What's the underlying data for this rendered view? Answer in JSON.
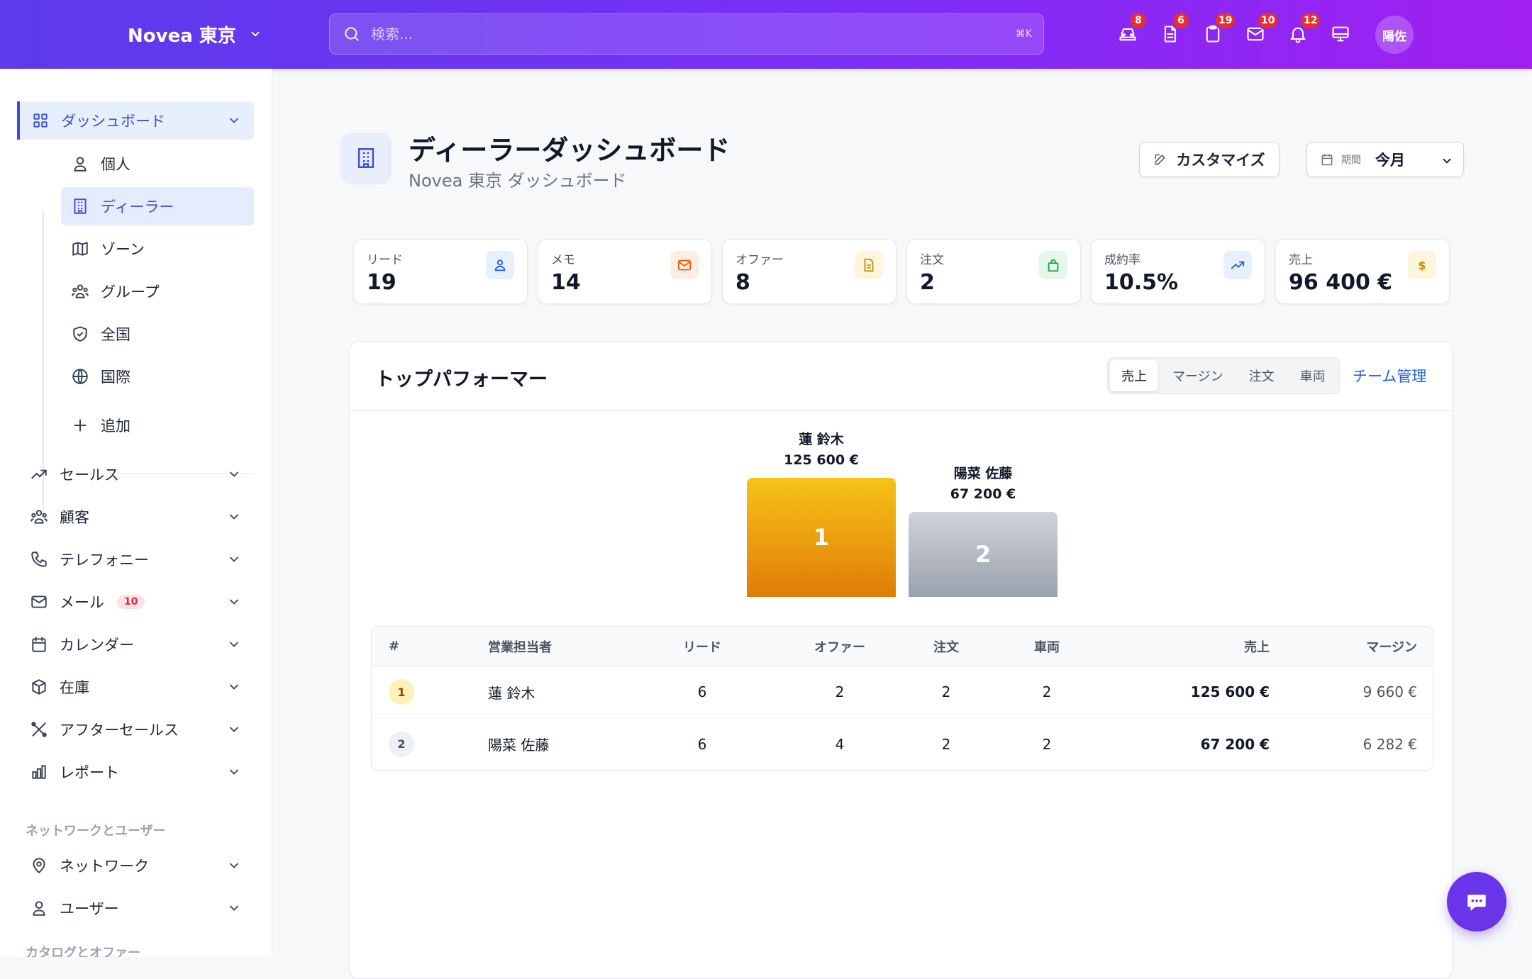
{
  "header": {
    "brand": "Novea 東京",
    "search_placeholder": "検索...",
    "shortcut": "⌘K",
    "icons": [
      {
        "name": "car-icon",
        "badge": "8"
      },
      {
        "name": "document-icon",
        "badge": "6"
      },
      {
        "name": "clipboard-icon",
        "badge": "19"
      },
      {
        "name": "mail-icon",
        "badge": "10"
      },
      {
        "name": "bell-icon",
        "badge": "12"
      },
      {
        "name": "monitor-icon",
        "badge": ""
      }
    ],
    "avatar": "陽佐"
  },
  "sidebar": {
    "dashboard": "ダッシュボード",
    "sub": [
      "個人",
      "ディーラー",
      "ゾーン",
      "グループ",
      "全国",
      "国際"
    ],
    "add": "追加",
    "items": [
      "セールス",
      "顧客",
      "テレフォニー",
      "メール",
      "カレンダー",
      "在庫",
      "アフターセールス",
      "レポート"
    ],
    "mail_badge": "10",
    "section_network": "ネットワークとユーザー",
    "network_items": [
      "ネットワーク",
      "ユーザー"
    ],
    "section_catalog": "カタログとオファー"
  },
  "page": {
    "title": "ディーラーダッシュボード",
    "subtitle": "Novea 東京 ダッシュボード",
    "customize": "カスタマイズ",
    "period_label": "期間",
    "period_value": "今月"
  },
  "kpis": [
    {
      "label": "リード",
      "value": "19",
      "icon": "user-icon",
      "color": "#2563eb",
      "bg": "#e8effd"
    },
    {
      "label": "メモ",
      "value": "14",
      "icon": "mail-icon",
      "color": "#ea580c",
      "bg": "#fdeee4"
    },
    {
      "label": "オファー",
      "value": "8",
      "icon": "document-icon",
      "color": "#ca8a04",
      "bg": "#fdf6dc"
    },
    {
      "label": "注文",
      "value": "2",
      "icon": "bag-icon",
      "color": "#16a34a",
      "bg": "#e4f7ea"
    },
    {
      "label": "成約率",
      "value": "10.5%",
      "icon": "trend-icon",
      "color": "#2563eb",
      "bg": "#e8effd"
    },
    {
      "label": "売上",
      "value": "96 400 €",
      "icon": "dollar-icon",
      "color": "#ca8a04",
      "bg": "#fdf6dc"
    }
  ],
  "performers": {
    "title": "トップパフォーマー",
    "tabs": [
      "売上",
      "マージン",
      "注文",
      "車両"
    ],
    "team_link": "チーム管理",
    "podium": [
      {
        "name": "蓮 鈴木",
        "amount": "125 600 €",
        "rank": "1",
        "value": 125600
      },
      {
        "name": "陽菜 佐藤",
        "amount": "67 200 €",
        "rank": "2",
        "value": 67200
      }
    ],
    "columns": [
      "#",
      "営業担当者",
      "リード",
      "オファー",
      "注文",
      "車両",
      "売上",
      "マージン"
    ],
    "rows": [
      {
        "rank": "1",
        "name": "蓮 鈴木",
        "leads": "6",
        "offers": "2",
        "orders": "2",
        "vehicles": "2",
        "sales": "125 600 €",
        "margin": "9 660 €"
      },
      {
        "rank": "2",
        "name": "陽菜 佐藤",
        "leads": "6",
        "offers": "4",
        "orders": "2",
        "vehicles": "2",
        "sales": "67 200 €",
        "margin": "6 282 €"
      }
    ]
  }
}
